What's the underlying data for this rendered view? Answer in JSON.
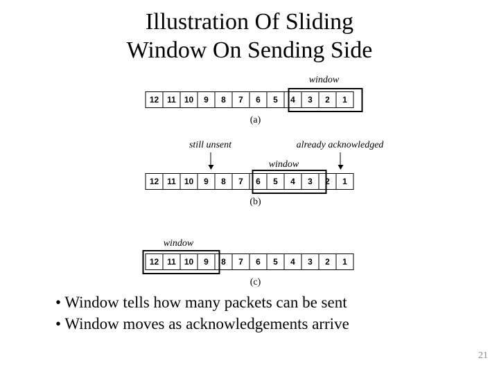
{
  "title_line1": "Illustration Of Sliding",
  "title_line2": "Window On Sending Side",
  "labels": {
    "window": "window",
    "still_unsent": "still unsent",
    "already_ack": "already acknowledged",
    "a": "(a)",
    "b": "(b)",
    "c": "(c)"
  },
  "cells": [
    "12",
    "11",
    "10",
    "9",
    "8",
    "7",
    "6",
    "5",
    "4",
    "3",
    "2",
    "1"
  ],
  "bullets": {
    "b1": "Window tells how many packets can be sent",
    "b2": "Window moves as acknowledgements arrive"
  },
  "page_number": "21"
}
